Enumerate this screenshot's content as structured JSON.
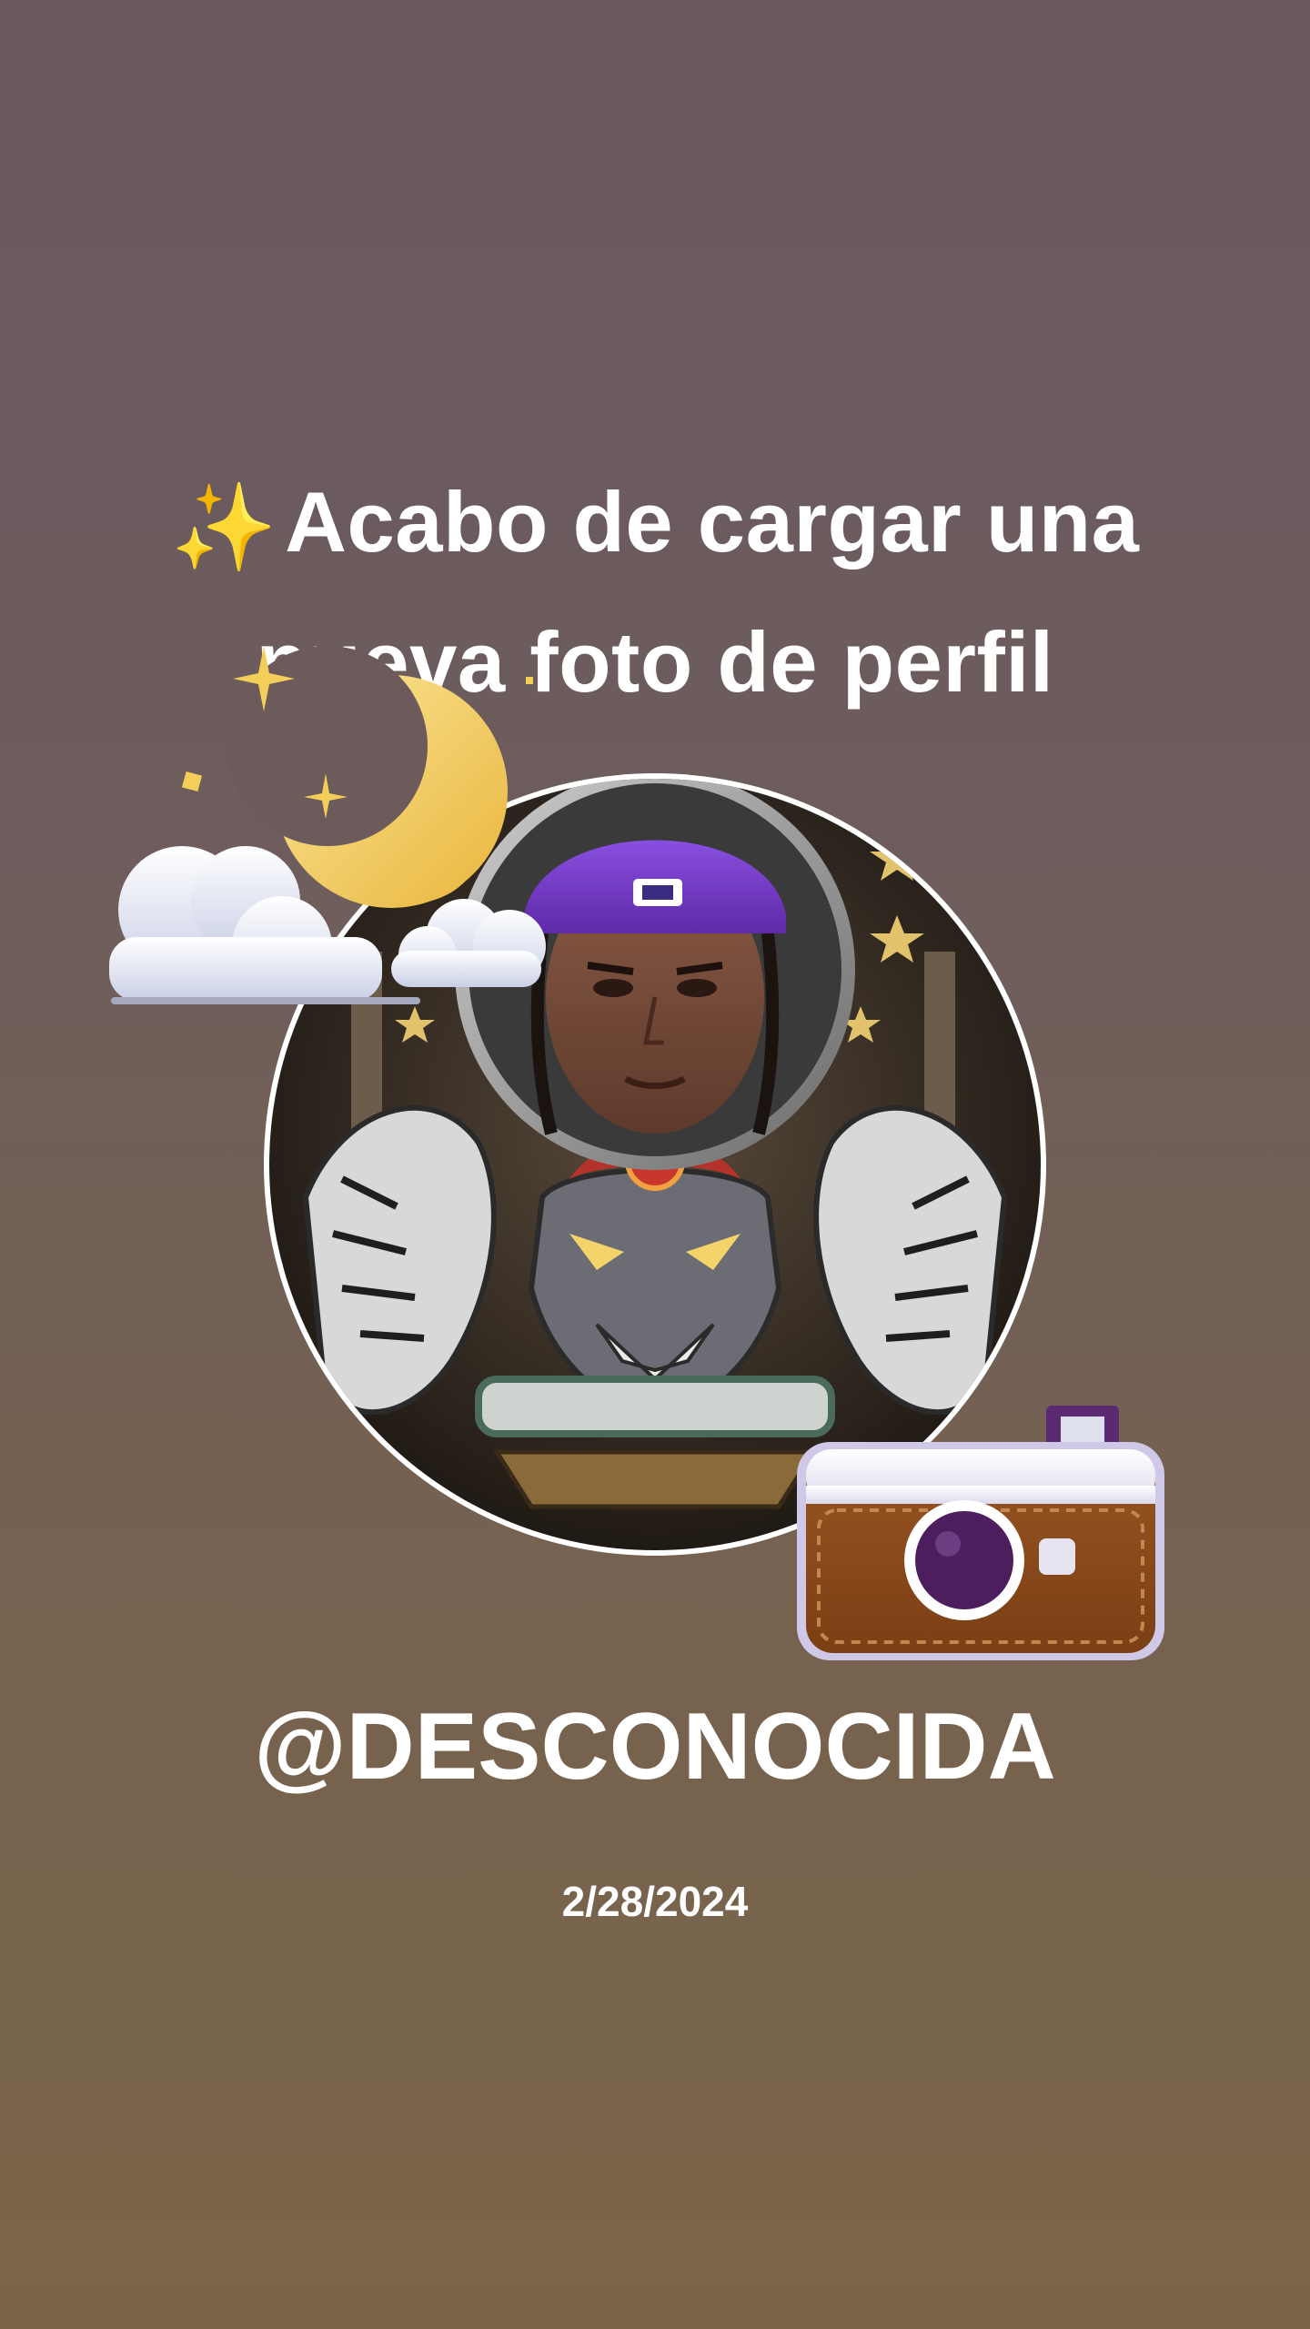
{
  "post": {
    "headline_line1": "Acabo de cargar una",
    "headline_line2": "nueva foto de perfil",
    "headline_sparkle": "✨",
    "username": "@DESCONOCIDA",
    "date": "2/28/2024"
  },
  "stickers": {
    "moon": "crescent-moon-clouds-icon",
    "camera": "camera-icon"
  },
  "colors": {
    "background_top": "#69585f",
    "background_bottom": "#7a6449",
    "text": "#ffffff",
    "cap": "#7a3fd0",
    "camera_body": "#8a4a18",
    "moon": "#f3cf5a"
  }
}
